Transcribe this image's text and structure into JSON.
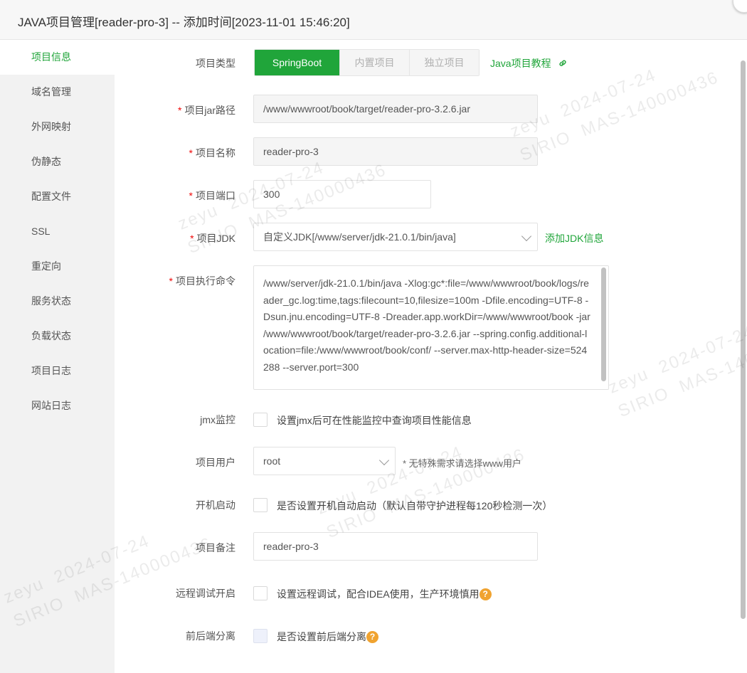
{
  "window": {
    "title": "JAVA项目管理[reader-pro-3] -- 添加时间[2023-11-01 15:46:20]"
  },
  "sidebar": {
    "items": [
      {
        "label": "项目信息",
        "active": true
      },
      {
        "label": "域名管理"
      },
      {
        "label": "外网映射"
      },
      {
        "label": "伪静态"
      },
      {
        "label": "配置文件"
      },
      {
        "label": "SSL"
      },
      {
        "label": "重定向"
      },
      {
        "label": "服务状态"
      },
      {
        "label": "负载状态"
      },
      {
        "label": "项目日志"
      },
      {
        "label": "网站日志"
      }
    ]
  },
  "form": {
    "project_type": {
      "label": "项目类型",
      "options": [
        "SpringBoot",
        "内置项目",
        "独立项目"
      ],
      "selected": "SpringBoot",
      "tutorial_link": "Java项目教程"
    },
    "jar_path": {
      "label": "项目jar路径",
      "required": "*",
      "value": "/www/wwwroot/book/target/reader-pro-3.2.6.jar"
    },
    "name": {
      "label": "项目名称",
      "required": "*",
      "value": "reader-pro-3"
    },
    "port": {
      "label": "项目端口",
      "required": "*",
      "value": "300"
    },
    "jdk": {
      "label": "项目JDK",
      "required": "*",
      "value": "自定义JDK[/www/server/jdk-21.0.1/bin/java]",
      "add_link": "添加JDK信息"
    },
    "command": {
      "label": "项目执行命令",
      "required": "*",
      "value": "/www/server/jdk-21.0.1/bin/java -Xlog:gc*:file=/www/wwwroot/book/logs/reader_gc.log:time,tags:filecount=10,filesize=100m -Dfile.encoding=UTF-8 -Dsun.jnu.encoding=UTF-8 -Dreader.app.workDir=/www/wwwroot/book -jar /www/wwwroot/book/target/reader-pro-3.2.6.jar --spring.config.additional-location=file:/www/wwwroot/book/conf/ --server.max-http-header-size=524288 --server.port=300"
    },
    "jmx": {
      "label": "jmx监控",
      "text": "设置jmx后可在性能监控中查询项目性能信息",
      "checked": false
    },
    "user": {
      "label": "项目用户",
      "value": "root",
      "hint": "* 无特殊需求请选择www用户"
    },
    "autostart": {
      "label": "开机启动",
      "text": "是否设置开机自动启动（默认自带守护进程每120秒检测一次）",
      "checked": false
    },
    "remark": {
      "label": "项目备注",
      "value": "reader-pro-3"
    },
    "remote_debug": {
      "label": "远程调试开启",
      "text": "设置远程调试，配合IDEA使用，生产环境慎用",
      "checked": false
    },
    "split": {
      "label": "前后端分离",
      "text": "是否设置前后端分离",
      "checked": false
    }
  },
  "watermark": {
    "line1": "zeyu  2024-07-24",
    "line2": "SIRIO  MAS-140000436"
  },
  "colors": {
    "accent": "#20a53a",
    "required": "#ef0808",
    "help": "#f0a330"
  }
}
